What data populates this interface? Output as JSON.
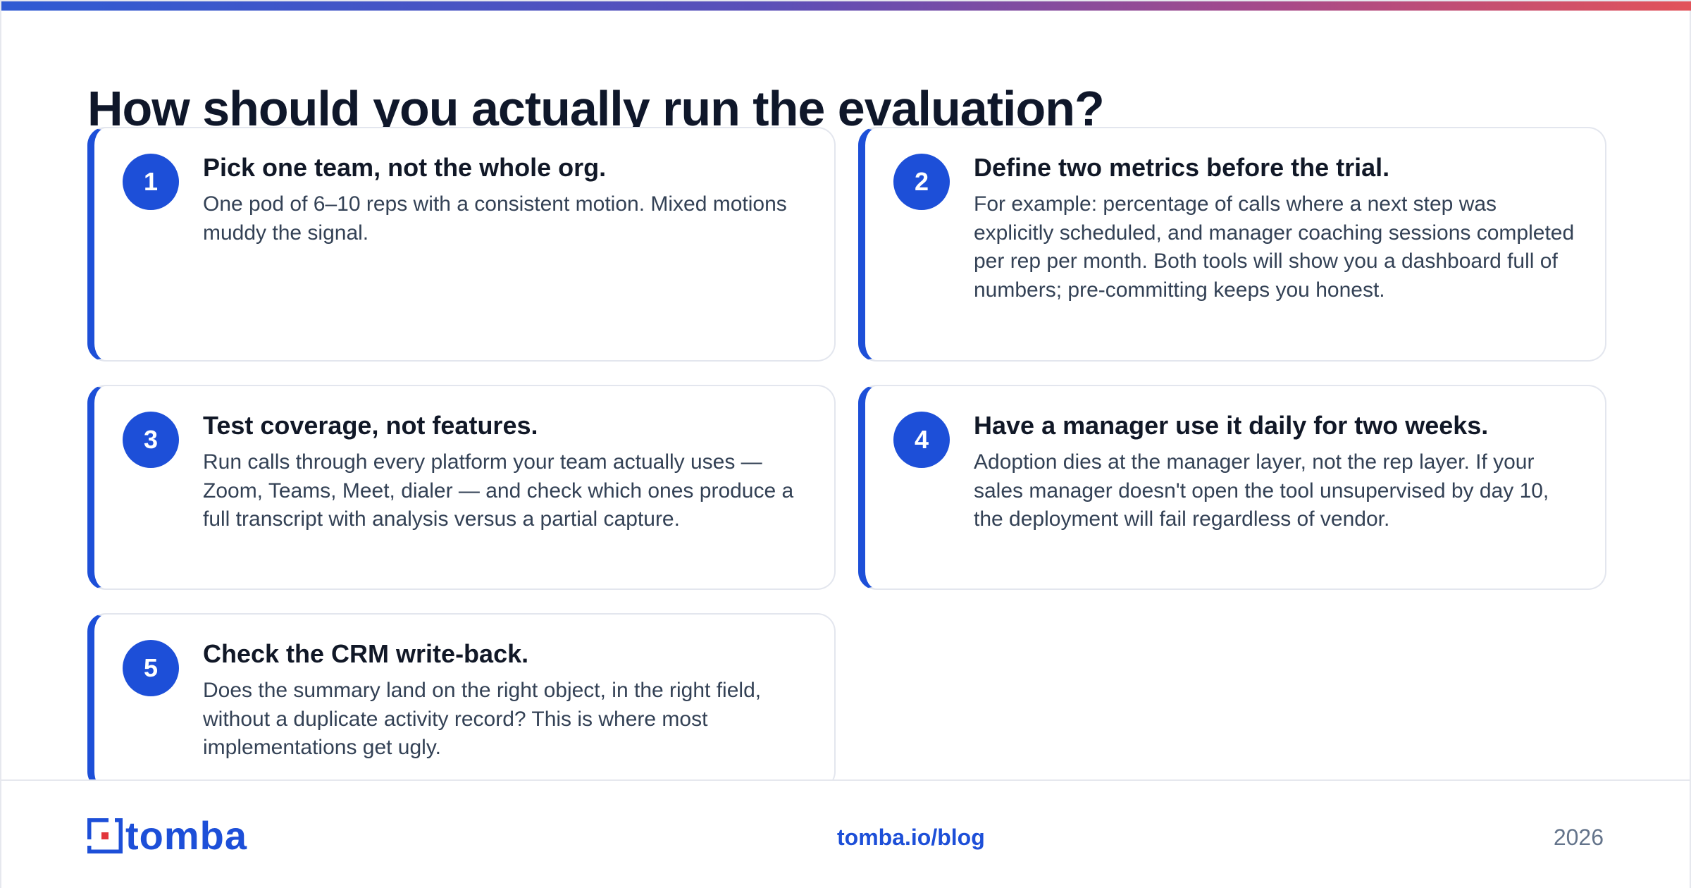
{
  "header": {
    "accent_gradient": [
      "#2f5bd3",
      "#5a4fb8",
      "#a64a8a",
      "#e2535a"
    ],
    "title": "How should you actually run the evaluation?"
  },
  "steps": [
    {
      "number": "1",
      "title": "Pick one team, not the whole org.",
      "body": "One pod of 6–10 reps with a consistent motion. Mixed motions muddy the signal."
    },
    {
      "number": "2",
      "title": "Define two metrics before the trial.",
      "body": "For example: percentage of calls where a next step was explicitly scheduled, and manager coaching sessions completed per rep per month. Both tools will show you a dashboard full of numbers; pre-committing keeps you honest."
    },
    {
      "number": "3",
      "title": "Test coverage, not features.",
      "body": "Run calls through every platform your team actually uses — Zoom, Teams, Meet, dialer — and check which ones produce a full transcript with analysis versus a partial capture."
    },
    {
      "number": "4",
      "title": "Have a manager use it daily for two weeks.",
      "body": "Adoption dies at the manager layer, not the rep layer. If your sales manager doesn't open the tool unsupervised by day 10, the deployment will fail regardless of vendor."
    },
    {
      "number": "5",
      "title": "Check the CRM write-back.",
      "body": "Does the summary land on the right object, in the right field, without a duplicate activity record? This is where most implementations get ugly."
    }
  ],
  "footer": {
    "logo_text": "tomba",
    "logo_icon": "tomba-logo-icon",
    "link": "tomba.io/blog",
    "year": "2026"
  },
  "colors": {
    "accent": "#1d4fd8",
    "title_text": "#0f172a",
    "body_text": "#334155",
    "muted": "#64748b"
  }
}
